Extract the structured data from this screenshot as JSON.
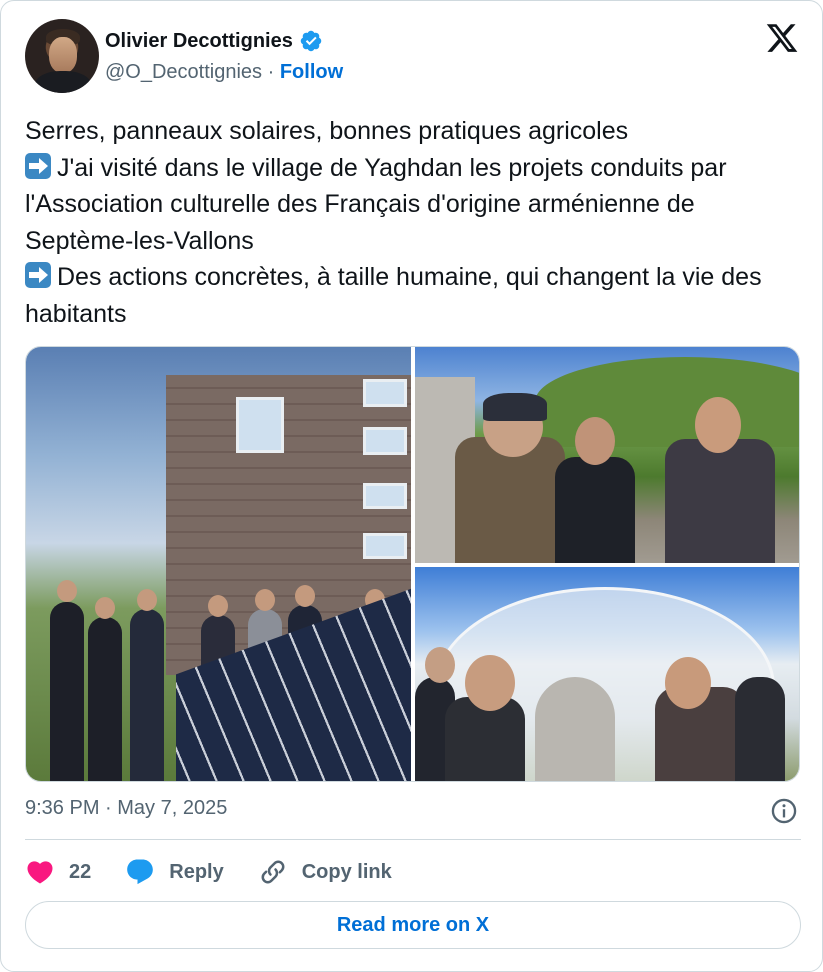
{
  "author": {
    "name": "Olivier Decottignies",
    "handle": "@O_Decottignies",
    "separator": "·",
    "follow_label": "Follow",
    "verified": true
  },
  "icons": {
    "verified": "verified-badge-icon",
    "x_logo": "x-logo-icon",
    "info": "info-icon",
    "like": "heart-icon",
    "reply": "reply-bubble-icon",
    "copy": "link-icon"
  },
  "tweet": {
    "line1": "Serres, panneaux solaires, bonnes pratiques agricoles",
    "line2": "J'ai visité dans le village de Yaghdan les projets conduits par l'Association culturelle des Français d'origine arménienne de Septème-les-Vallons",
    "line3": "Des actions concrètes, à taille humaine, qui changent la vie des habitants",
    "timestamp": "9:36 PM · May 7, 2025"
  },
  "actions": {
    "like_count": "22",
    "reply_label": "Reply",
    "copy_label": "Copy link"
  },
  "read_more_label": "Read more on X",
  "colors": {
    "accent": "#006fd6",
    "like": "#f91880",
    "reply": "#1d9bf0",
    "verified": "#1d9bf0",
    "muted": "#536471"
  }
}
